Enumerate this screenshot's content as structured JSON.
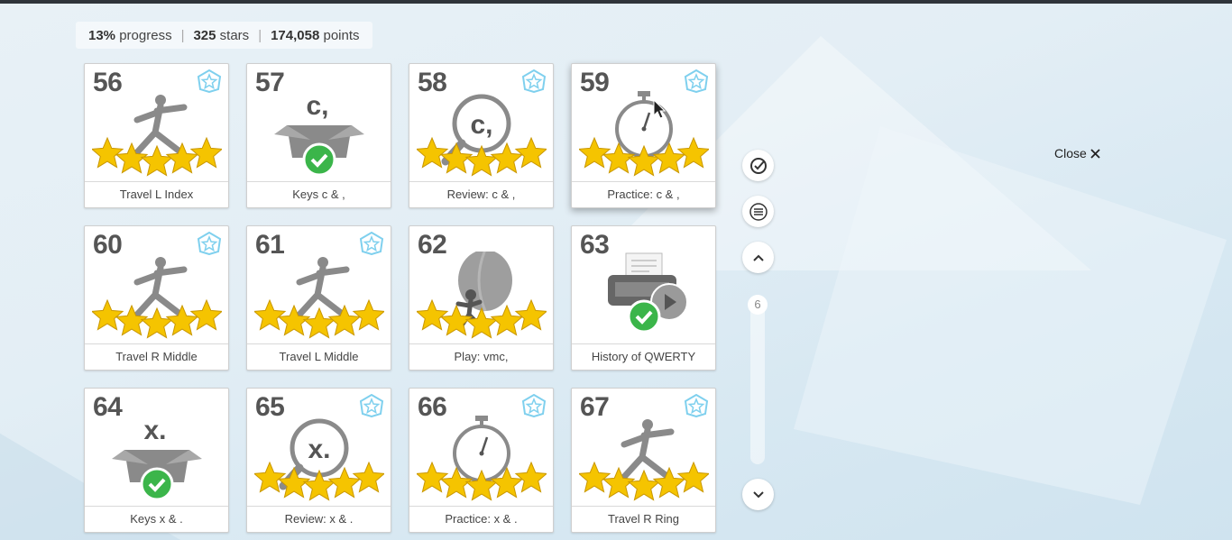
{
  "stats": {
    "progress_value": "13%",
    "progress_label": "progress",
    "stars_value": "325",
    "stars_label": "stars",
    "points_value": "174,058",
    "points_label": "points"
  },
  "lessons": [
    {
      "number": "56",
      "label": "Travel L Index",
      "art": "pose-icon",
      "stars": 5,
      "badge": true,
      "completed": false
    },
    {
      "number": "57",
      "label": "Keys c & ,",
      "art": "box-icon",
      "key": "c,",
      "stars": 0,
      "badge": false,
      "completed": true
    },
    {
      "number": "58",
      "label": "Review: c & ,",
      "art": "magnifier-icon",
      "key": "c,",
      "stars": 5,
      "badge": true,
      "completed": false
    },
    {
      "number": "59",
      "label": "Practice: c & ,",
      "art": "stopwatch-icon",
      "stars": 5,
      "badge": true,
      "completed": false
    },
    {
      "number": "60",
      "label": "Travel R Middle",
      "art": "pose-icon",
      "stars": 5,
      "badge": true,
      "completed": false
    },
    {
      "number": "61",
      "label": "Travel L Middle",
      "art": "pose-icon",
      "stars": 5,
      "badge": true,
      "completed": false
    },
    {
      "number": "62",
      "label": "Play: vmc,",
      "art": "balloon-icon",
      "stars": 5,
      "badge": false,
      "completed": false
    },
    {
      "number": "63",
      "label": "History of QWERTY",
      "art": "typewriter-icon",
      "stars": 0,
      "badge": false,
      "completed": true
    },
    {
      "number": "64",
      "label": "Keys x & .",
      "art": "box-icon",
      "key": "x.",
      "stars": 0,
      "badge": false,
      "completed": true
    },
    {
      "number": "65",
      "label": "Review: x & .",
      "art": "magnifier-icon",
      "key": "x.",
      "stars": 5,
      "badge": true,
      "completed": false
    },
    {
      "number": "66",
      "label": "Practice: x & .",
      "art": "stopwatch-icon",
      "stars": 5,
      "badge": true,
      "completed": false
    },
    {
      "number": "67",
      "label": "Travel R Ring",
      "art": "pose-icon",
      "stars": 5,
      "badge": true,
      "completed": false
    }
  ],
  "controls": {
    "goals_icon": "check-circle-icon",
    "menu_icon": "menu-icon",
    "up_icon": "chevron-up-icon",
    "down_icon": "chevron-down-icon",
    "scroll_position": "6"
  },
  "close": {
    "label": "Close",
    "icon": "close-icon"
  },
  "colors": {
    "star": "#f5c400",
    "check": "#3bb54a",
    "badge": "#7fd0ee",
    "art_gray": "#8a8a8a"
  }
}
